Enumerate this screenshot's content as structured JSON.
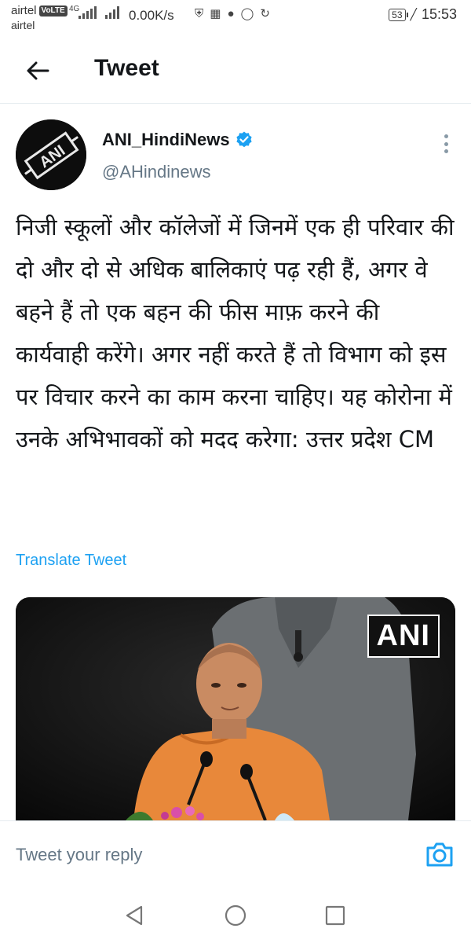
{
  "status_bar": {
    "carrier1": "airtel",
    "volte": "VoLTE",
    "network": "4G",
    "carrier2": "airtel",
    "speed": "0.00K/s",
    "battery": "53",
    "time": "15:53"
  },
  "header": {
    "title": "Tweet"
  },
  "tweet": {
    "author_name": "ANI_HindiNews",
    "author_handle": "@AHindinews",
    "avatar_text": "ANI",
    "text": "निजी स्कूलों और कॉलेजों में जिनमें एक ही परिवार की दो और दो से अधिक बालिकाएं पढ़ रही हैं, अगर वे बहने हैं तो एक बहन की फीस माफ़ करने की कार्यवाही करेंगे। अगर नहीं करते हैं तो विभाग को इस पर विचार करने का काम करना चाहिए। यह कोरोना में उनके अभिभावकों को मदद करेगा: उत्तर प्रदेश CM",
    "translate_label": "Translate Tweet",
    "media_watermark": "ANI"
  },
  "reply": {
    "placeholder": "Tweet your reply"
  },
  "colors": {
    "accent": "#1da1f2",
    "text": "#14171a",
    "secondary": "#657786"
  }
}
